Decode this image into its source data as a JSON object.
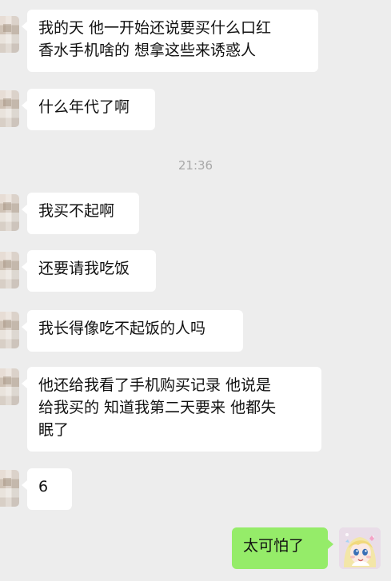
{
  "messages": [
    {
      "side": "left",
      "text": "我的天 他一开始还说要买什么口红\n香水手机啥的 想拿这些来诱惑人"
    },
    {
      "side": "left",
      "text": "什么年代了啊"
    },
    {
      "side": "left",
      "text": "我买不起啊"
    },
    {
      "side": "left",
      "text": "还要请我吃饭"
    },
    {
      "side": "left",
      "text": "我长得像吃不起饭的人吗"
    },
    {
      "side": "left",
      "text": "他还给我看了手机购买记录 他说是\n给我买的 知道我第二天要来 他都失\n眠了"
    },
    {
      "side": "left",
      "text": "6"
    },
    {
      "side": "right",
      "text": "太可怕了"
    }
  ],
  "timestamp": "21:36",
  "colors": {
    "background": "#ededed",
    "bubble_left": "#ffffff",
    "bubble_right": "#95ec69",
    "timestamp_text": "#a8a8a8"
  }
}
